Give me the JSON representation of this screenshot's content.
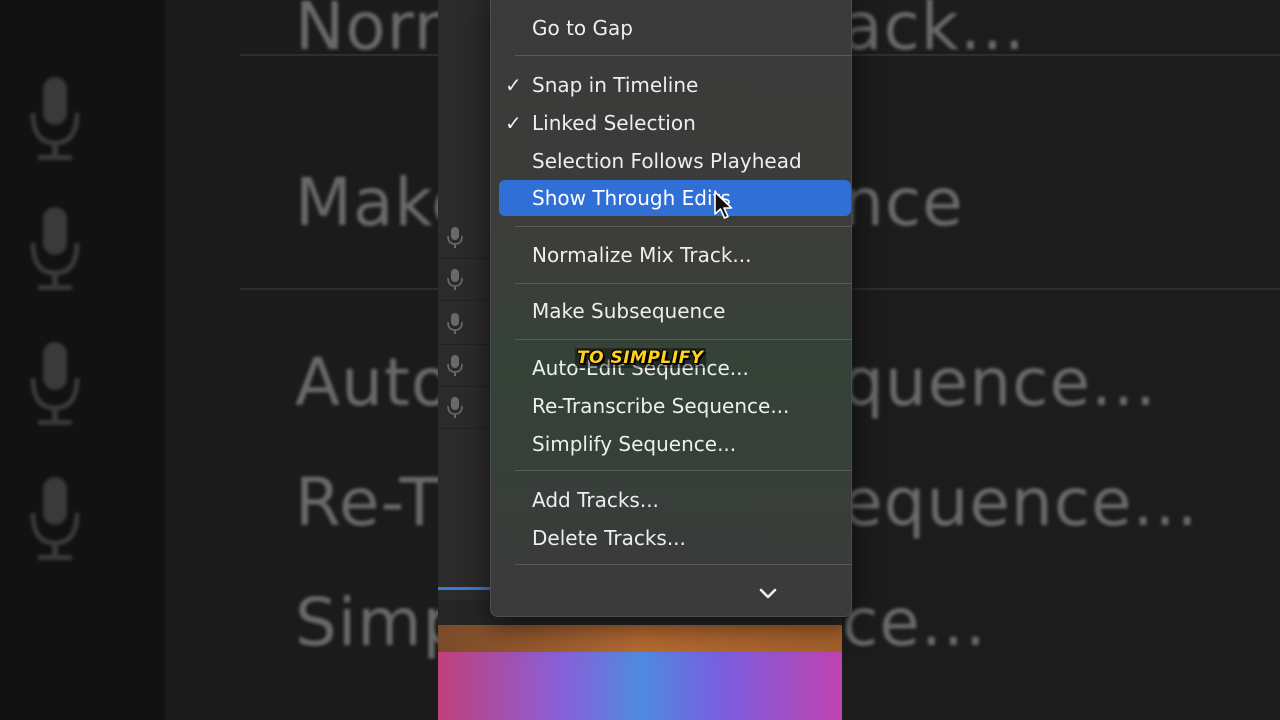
{
  "background": {
    "left_fragments": [
      "Norn",
      "Make",
      "Auto",
      "Re-T",
      "Simp"
    ],
    "right_fragments": [
      "ack...",
      "nce",
      "quence...",
      "equence...",
      "ce..."
    ]
  },
  "menu": {
    "items": [
      {
        "label": "Go to Gap",
        "checked": false,
        "highlighted": false
      },
      {
        "label": "Snap in Timeline",
        "checked": true,
        "highlighted": false
      },
      {
        "label": "Linked Selection",
        "checked": true,
        "highlighted": false
      },
      {
        "label": "Selection Follows Playhead",
        "checked": false,
        "highlighted": false
      },
      {
        "label": "Show Through Edits",
        "checked": false,
        "highlighted": true
      },
      {
        "label": "Normalize Mix Track...",
        "checked": false,
        "highlighted": false
      },
      {
        "label": "Make Subsequence",
        "checked": false,
        "highlighted": false
      },
      {
        "label": "Auto-Edit Sequence...",
        "checked": false,
        "highlighted": false
      },
      {
        "label": "Re-Transcribe Sequence...",
        "checked": false,
        "highlighted": false
      },
      {
        "label": "Simplify Sequence...",
        "checked": false,
        "highlighted": false
      },
      {
        "label": "Add Tracks...",
        "checked": false,
        "highlighted": false
      },
      {
        "label": "Delete Tracks...",
        "checked": false,
        "highlighted": false
      }
    ],
    "check_glyph": "✓",
    "more_icon": "chevron-down-icon"
  },
  "caption": "TO SIMPLIFY",
  "colors": {
    "highlight": "#2f6fd6",
    "caption": "#ffd21f"
  }
}
